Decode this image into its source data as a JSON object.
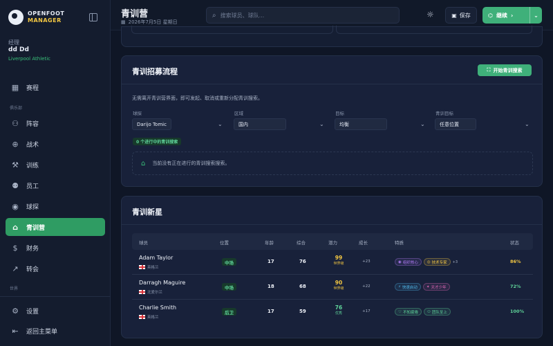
{
  "app": {
    "name_line1": "OPENFOOT",
    "name_line2": "MANAGER"
  },
  "manager": {
    "role": "经理",
    "name": "dd Dd",
    "club": "Liverpool Athletic"
  },
  "nav": {
    "schedule": "赛程",
    "section_club": "俱乐部",
    "squad": "阵容",
    "tactics": "战术",
    "training": "训练",
    "staff": "员工",
    "scouting": "球探",
    "youth": "青训营",
    "finances": "财务",
    "transfers": "转会",
    "section_more": "世界",
    "settings": "设置",
    "main_menu": "返回主菜单"
  },
  "header": {
    "title": "青训营",
    "date": "2026年7月5日 星期日",
    "search_placeholder": "搜索球员、球队...",
    "save_label": "保存",
    "continue_label": "继续"
  },
  "recruit": {
    "title": "青训招募流程",
    "start_button": "开始青训搜索",
    "description": "无需离开青训营界面，即可发起、取消或重新分配青训搜索。",
    "fields": [
      {
        "label": "球探",
        "value": "Darijo Tomic"
      },
      {
        "label": "区域",
        "value": "国内"
      },
      {
        "label": "目标",
        "value": "均衡"
      },
      {
        "label": "青训目标",
        "value": "任意位置"
      }
    ],
    "active_badge": "0 个进行中的青训搜索",
    "empty_message": "当前没有正在进行的青训搜索搜索。"
  },
  "prospects": {
    "title": "青训新星",
    "columns": [
      "球员",
      "位置",
      "年龄",
      "综合",
      "潜力",
      "成长",
      "特质",
      "状态"
    ],
    "rows": [
      {
        "name": "Adam Taylor",
        "nationality": "英格兰",
        "position": "中场",
        "age": "17",
        "overall": "76",
        "potential": "99",
        "potential_label": "世界级",
        "potential_color": "#f3c742",
        "growth": "+23",
        "traits": [
          {
            "label": "组织核心",
            "icon": "◉",
            "color": "#b07bf5"
          },
          {
            "label": "技术专家",
            "icon": "◎",
            "color": "#f3c742"
          }
        ],
        "more": "+3",
        "status": "86%",
        "status_color": "#f3c742"
      },
      {
        "name": "Darragh Maguire",
        "nationality": "北爱尔兰",
        "position": "中场",
        "age": "18",
        "overall": "68",
        "potential": "90",
        "potential_label": "世界级",
        "potential_color": "#f3c742",
        "growth": "+22",
        "traits": [
          {
            "label": "快速启动",
            "icon": "⚡",
            "color": "#4fb4e6"
          },
          {
            "label": "天才少年",
            "icon": "✦",
            "color": "#e46ab8"
          }
        ],
        "more": "",
        "status": "72%",
        "status_color": "#5fd49a"
      },
      {
        "name": "Charlie Smith",
        "nationality": "英格兰",
        "position": "后卫",
        "age": "17",
        "overall": "59",
        "potential": "76",
        "potential_label": "优秀",
        "potential_color": "#5fd49a",
        "growth": "+17",
        "traits": [
          {
            "label": "不知疲倦",
            "icon": "♡",
            "color": "#5fd49a"
          },
          {
            "label": "团队至上",
            "icon": "⚇",
            "color": "#5fd49a"
          }
        ],
        "more": "",
        "status": "100%",
        "status_color": "#5fd49a"
      }
    ]
  }
}
